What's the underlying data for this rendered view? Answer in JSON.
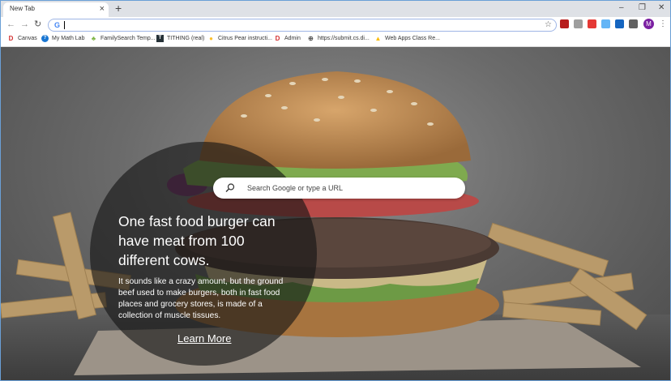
{
  "browser": {
    "tab_title": "New Tab",
    "tab_close": "×",
    "new_tab": "+",
    "window_controls": {
      "minimize": "–",
      "restore": "❐",
      "close": "✕"
    },
    "nav": {
      "back": "←",
      "forward": "→",
      "reload": "↻"
    },
    "omnibox_logo": "G",
    "omnibox_value": "",
    "star": "☆",
    "avatar_initial": "M",
    "menu": "⋮"
  },
  "bookmarks": [
    {
      "label": "Canvas",
      "icon": "canvas-icon"
    },
    {
      "label": "My Math Lab",
      "icon": "mymathlab-icon"
    },
    {
      "label": "FamilySearch Temp...",
      "icon": "familysearch-icon"
    },
    {
      "label": "TITHING (real)",
      "icon": "tithing-icon"
    },
    {
      "label": "Citrus Pear instructi...",
      "icon": "pear-icon"
    },
    {
      "label": "Admin",
      "icon": "admin-icon"
    },
    {
      "label": "https://submit.cs.di...",
      "icon": "globe-icon"
    },
    {
      "label": "Web Apps Class Re...",
      "icon": "drive-icon"
    }
  ],
  "search": {
    "placeholder": "Search Google or type a URL"
  },
  "fact": {
    "headline": "One fast food burger can have meat from 100 different cows.",
    "body": "It sounds like a crazy amount, but the ground beef used to make burgers, both in fast food places and grocery stores, is made of a collection of muscle tissues.",
    "link": "Learn More"
  },
  "colors": {
    "accent": "#4285f4",
    "avatar": "#7b1fa2",
    "canvas_red": "#d32f2f"
  }
}
